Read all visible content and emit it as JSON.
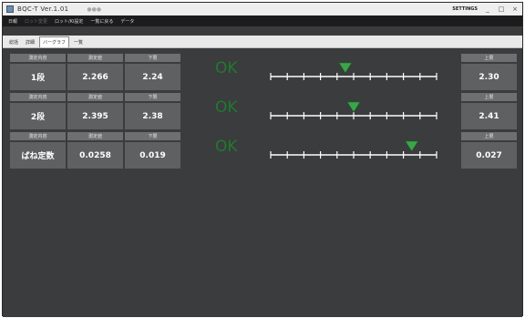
{
  "window": {
    "title": "BQC-T Ver.1.01",
    "subtitle": "●●●",
    "settings_label": "SETTINGS"
  },
  "window_buttons": {
    "minimize": "_",
    "maximize": "□",
    "close": "×"
  },
  "menu": [
    {
      "label": "日報",
      "dim": false
    },
    {
      "label": "ロット変更",
      "dim": true
    },
    {
      "label": "ロット/Ki設定",
      "dim": false
    },
    {
      "label": "一覧に戻る",
      "dim": false
    },
    {
      "label": "データ",
      "dim": false
    }
  ],
  "tabs": [
    {
      "label": "総括",
      "active": false
    },
    {
      "label": "詳細",
      "active": false
    },
    {
      "label": "バーグラフ",
      "active": true
    },
    {
      "label": "一覧",
      "active": false
    }
  ],
  "rows": [
    {
      "item_head": "測定内容",
      "item": "1段",
      "value_head": "測定値",
      "value": "2.266",
      "lower_head": "下限",
      "lower": "2.24",
      "status": "OK",
      "upper_head": "上限",
      "upper": "2.30",
      "marker": 0.45
    },
    {
      "item_head": "測定内容",
      "item": "2段",
      "value_head": "測定値",
      "value": "2.395",
      "lower_head": "下限",
      "lower": "2.38",
      "status": "OK",
      "upper_head": "上限",
      "upper": "2.41",
      "marker": 0.5
    },
    {
      "item_head": "測定内容",
      "item": "ばね定数",
      "value_head": "測定値",
      "value": "0.0258",
      "lower_head": "下限",
      "lower": "0.019",
      "status": "OK",
      "upper_head": "上限",
      "upper": "0.027",
      "marker": 0.85
    }
  ],
  "colors": {
    "ok": "#1f7a2e",
    "marker": "#3aa64a",
    "scale": "#ffffff"
  }
}
